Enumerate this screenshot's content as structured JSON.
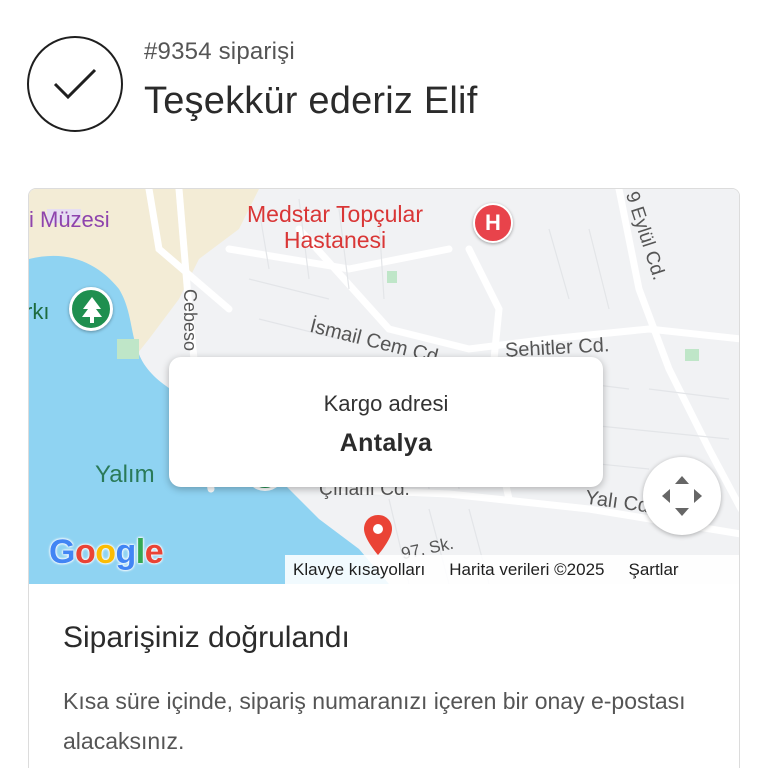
{
  "order": {
    "number_label": "#9354 siparişi",
    "thanks_text": "Teşekkür ederiz Elif"
  },
  "map": {
    "labels": {
      "museum": "i Müzesi",
      "hospital_line1": "Medstar Topçular",
      "hospital_line2": "Hastanesi",
      "hospital_badge": "H",
      "park": "rkı",
      "yalim": "Yalım",
      "ismail": "İsmail Cem Cd",
      "sehitler": "Şehitler Cd.",
      "cebesoy": "Cebeso",
      "eylul": "9 Eylül Cd.",
      "cinarli": "Çınarlı Cd.",
      "yali": "Yalı Cd",
      "sk": "97. Sk."
    },
    "address_bubble": {
      "label": "Kargo adresi",
      "city": "Antalya"
    },
    "google_logo": [
      "G",
      "o",
      "o",
      "g",
      "l",
      "e"
    ],
    "attribution": {
      "keyboard_shortcuts": "Klavye kısayolları",
      "map_data": "Harita verileri ©2025",
      "terms": "Şartlar"
    },
    "colors": {
      "water": "#8fd3f2",
      "land": "#f1f2f4",
      "road": "#ffffff",
      "hospital": "#e8434b",
      "park": "#1f8f4f",
      "marker": "#ea4335"
    }
  },
  "confirmation": {
    "title": "Siparişiniz doğrulandı",
    "description": "Kısa süre içinde, sipariş numaranızı içeren bir onay e-postası alacaksınız."
  }
}
